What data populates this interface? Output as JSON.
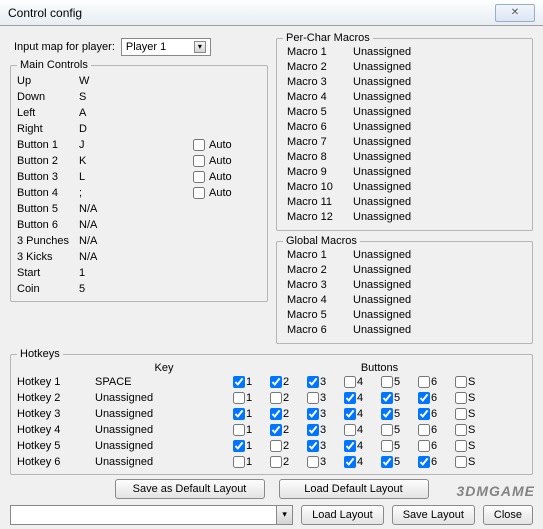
{
  "window": {
    "title": "Control config"
  },
  "player": {
    "label": "Input map for player:",
    "selected": "Player 1"
  },
  "mainControls": {
    "legend": "Main Controls",
    "autoLabel": "Auto",
    "rows": [
      {
        "label": "Up",
        "value": "W",
        "auto": null
      },
      {
        "label": "Down",
        "value": "S",
        "auto": null
      },
      {
        "label": "Left",
        "value": "A",
        "auto": null
      },
      {
        "label": "Right",
        "value": "D",
        "auto": null
      },
      {
        "label": "Button 1",
        "value": "J",
        "auto": false
      },
      {
        "label": "Button 2",
        "value": "K",
        "auto": false
      },
      {
        "label": "Button 3",
        "value": "L",
        "auto": false
      },
      {
        "label": "Button 4",
        "value": ";",
        "auto": false
      },
      {
        "label": "Button 5",
        "value": "N/A",
        "auto": null
      },
      {
        "label": "Button 6",
        "value": "N/A",
        "auto": null
      },
      {
        "label": "3 Punches",
        "value": "N/A",
        "auto": null
      },
      {
        "label": "3 Kicks",
        "value": "N/A",
        "auto": null
      },
      {
        "label": "Start",
        "value": "1",
        "auto": null
      },
      {
        "label": "Coin",
        "value": "5",
        "auto": null
      }
    ]
  },
  "perChar": {
    "legend": "Per-Char Macros",
    "rows": [
      {
        "label": "Macro 1",
        "value": "Unassigned"
      },
      {
        "label": "Macro 2",
        "value": "Unassigned"
      },
      {
        "label": "Macro 3",
        "value": "Unassigned"
      },
      {
        "label": "Macro 4",
        "value": "Unassigned"
      },
      {
        "label": "Macro 5",
        "value": "Unassigned"
      },
      {
        "label": "Macro 6",
        "value": "Unassigned"
      },
      {
        "label": "Macro 7",
        "value": "Unassigned"
      },
      {
        "label": "Macro 8",
        "value": "Unassigned"
      },
      {
        "label": "Macro 9",
        "value": "Unassigned"
      },
      {
        "label": "Macro 10",
        "value": "Unassigned"
      },
      {
        "label": "Macro 11",
        "value": "Unassigned"
      },
      {
        "label": "Macro 12",
        "value": "Unassigned"
      }
    ]
  },
  "global": {
    "legend": "Global Macros",
    "rows": [
      {
        "label": "Macro 1",
        "value": "Unassigned"
      },
      {
        "label": "Macro 2",
        "value": "Unassigned"
      },
      {
        "label": "Macro 3",
        "value": "Unassigned"
      },
      {
        "label": "Macro 4",
        "value": "Unassigned"
      },
      {
        "label": "Macro 5",
        "value": "Unassigned"
      },
      {
        "label": "Macro 6",
        "value": "Unassigned"
      }
    ]
  },
  "hotkeys": {
    "legend": "Hotkeys",
    "headKey": "Key",
    "headButtons": "Buttons",
    "cols": [
      "1",
      "2",
      "3",
      "4",
      "5",
      "6",
      "S"
    ],
    "rows": [
      {
        "name": "Hotkey 1",
        "key": "SPACE",
        "btns": [
          true,
          true,
          true,
          false,
          false,
          false,
          false
        ]
      },
      {
        "name": "Hotkey 2",
        "key": "Unassigned",
        "btns": [
          false,
          false,
          false,
          true,
          true,
          true,
          false
        ]
      },
      {
        "name": "Hotkey 3",
        "key": "Unassigned",
        "btns": [
          true,
          true,
          true,
          true,
          true,
          true,
          false
        ]
      },
      {
        "name": "Hotkey 4",
        "key": "Unassigned",
        "btns": [
          false,
          true,
          true,
          false,
          false,
          false,
          false
        ]
      },
      {
        "name": "Hotkey 5",
        "key": "Unassigned",
        "btns": [
          true,
          false,
          true,
          true,
          false,
          false,
          false
        ]
      },
      {
        "name": "Hotkey 6",
        "key": "Unassigned",
        "btns": [
          false,
          false,
          false,
          true,
          true,
          true,
          false
        ]
      }
    ]
  },
  "buttons": {
    "saveDefault": "Save as Default Layout",
    "loadDefault": "Load Default Layout",
    "loadLayout": "Load Layout",
    "saveLayout": "Save Layout",
    "close": "Close"
  },
  "watermark": "3DMGAME"
}
